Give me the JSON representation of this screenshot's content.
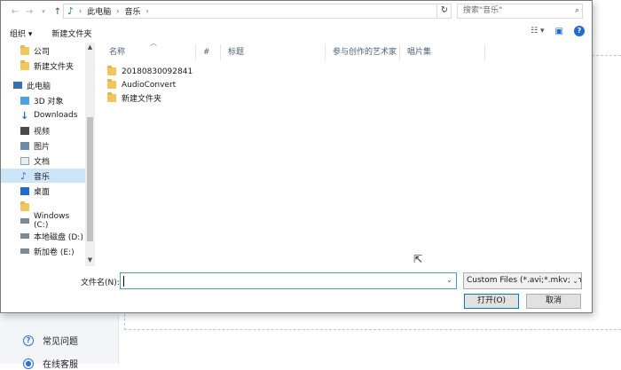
{
  "address": {
    "path": [
      "此电脑",
      "音乐"
    ],
    "search_placeholder": "搜索\"音乐\""
  },
  "toolbar": {
    "organize": "组织 ▾",
    "new_folder": "新建文件夹"
  },
  "nav": {
    "items": [
      {
        "label": "公司",
        "icon": "folder-icon"
      },
      {
        "label": "新建文件夹",
        "icon": "folder-icon"
      },
      {
        "label": "此电脑",
        "icon": "computer-icon"
      },
      {
        "label": "3D 对象",
        "icon": "3d-objects-icon"
      },
      {
        "label": "Downloads",
        "icon": "download-icon"
      },
      {
        "label": "视频",
        "icon": "video-icon"
      },
      {
        "label": "图片",
        "icon": "pictures-icon"
      },
      {
        "label": "文档",
        "icon": "documents-icon"
      },
      {
        "label": "音乐",
        "icon": "music-icon",
        "selected": true
      },
      {
        "label": "桌面",
        "icon": "desktop-icon"
      },
      {
        "label": "",
        "icon": "folder-icon"
      },
      {
        "label": "Windows (C:)",
        "icon": "drive-icon"
      },
      {
        "label": "本地磁盘 (D:)",
        "icon": "drive-icon"
      },
      {
        "label": "新加卷 (E:)",
        "icon": "drive-icon"
      }
    ]
  },
  "columns": [
    "名称",
    "#",
    "标题",
    "参与创作的艺术家",
    "唱片集"
  ],
  "files": [
    {
      "name": "20180830092841",
      "icon": "folder-icon"
    },
    {
      "name": "AudioConvert",
      "icon": "folder-icon"
    },
    {
      "name": "新建文件夹",
      "icon": "folder-icon"
    }
  ],
  "bottom": {
    "filename_label": "文件名(N):",
    "filename_value": "",
    "filter_value": "Custom Files (*.avi;*.mkv;*.mov",
    "open_label": "打开(O)",
    "cancel_label": "取消"
  },
  "background": {
    "links": [
      "常见问题",
      "在线客服"
    ]
  },
  "colors": {
    "selection": "#cde6f7",
    "accent": "#0078d7",
    "folder": "#f2c65b"
  }
}
